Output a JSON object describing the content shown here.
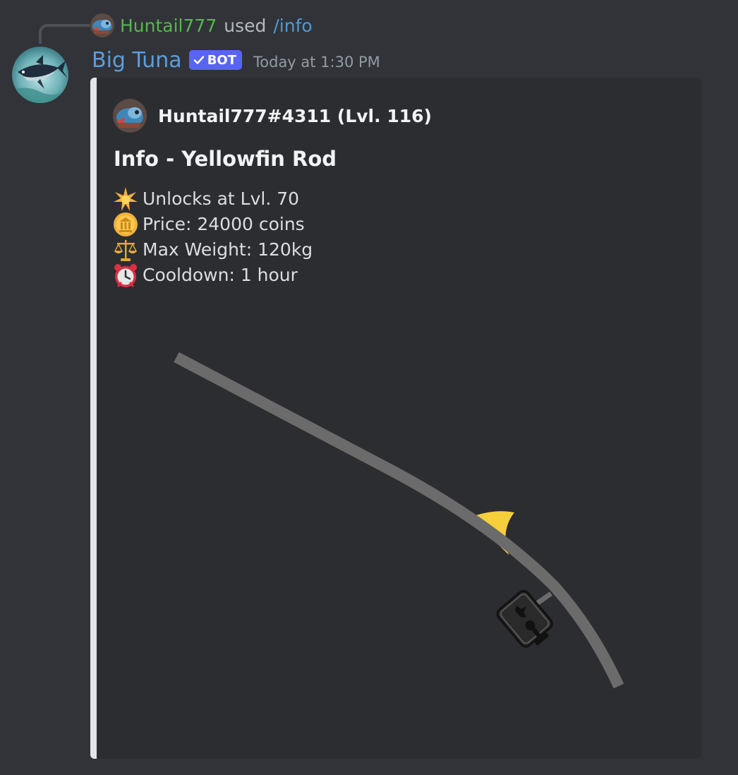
{
  "interaction": {
    "user": "Huntail777",
    "used_text": "used",
    "command": "/info"
  },
  "message": {
    "username": "Big Tuna",
    "bot_tag": "BOT",
    "timestamp": "Today at 1:30 PM"
  },
  "embed": {
    "accent_color": "#e3e5e8",
    "author": "Huntail777#4311 (Lvl. 116)",
    "title": "Info - Yellowfin Rod",
    "lines": [
      {
        "icon": "star-icon",
        "text": "Unlocks at Lvl. 70"
      },
      {
        "icon": "coin-icon",
        "text": "Price: 24000 coins"
      },
      {
        "icon": "scales-icon",
        "text": "Max Weight: 120kg"
      },
      {
        "icon": "alarm-clock-icon",
        "text": "Cooldown: 1 hour"
      }
    ],
    "image": "fishing-rod-image"
  },
  "colors": {
    "background": "#313338",
    "embed_bg": "#2b2d31",
    "username": "#5b9ee0",
    "interaction_user": "#57b64f",
    "command": "#4e9ad8",
    "bot_tag_bg": "#5865f2"
  }
}
